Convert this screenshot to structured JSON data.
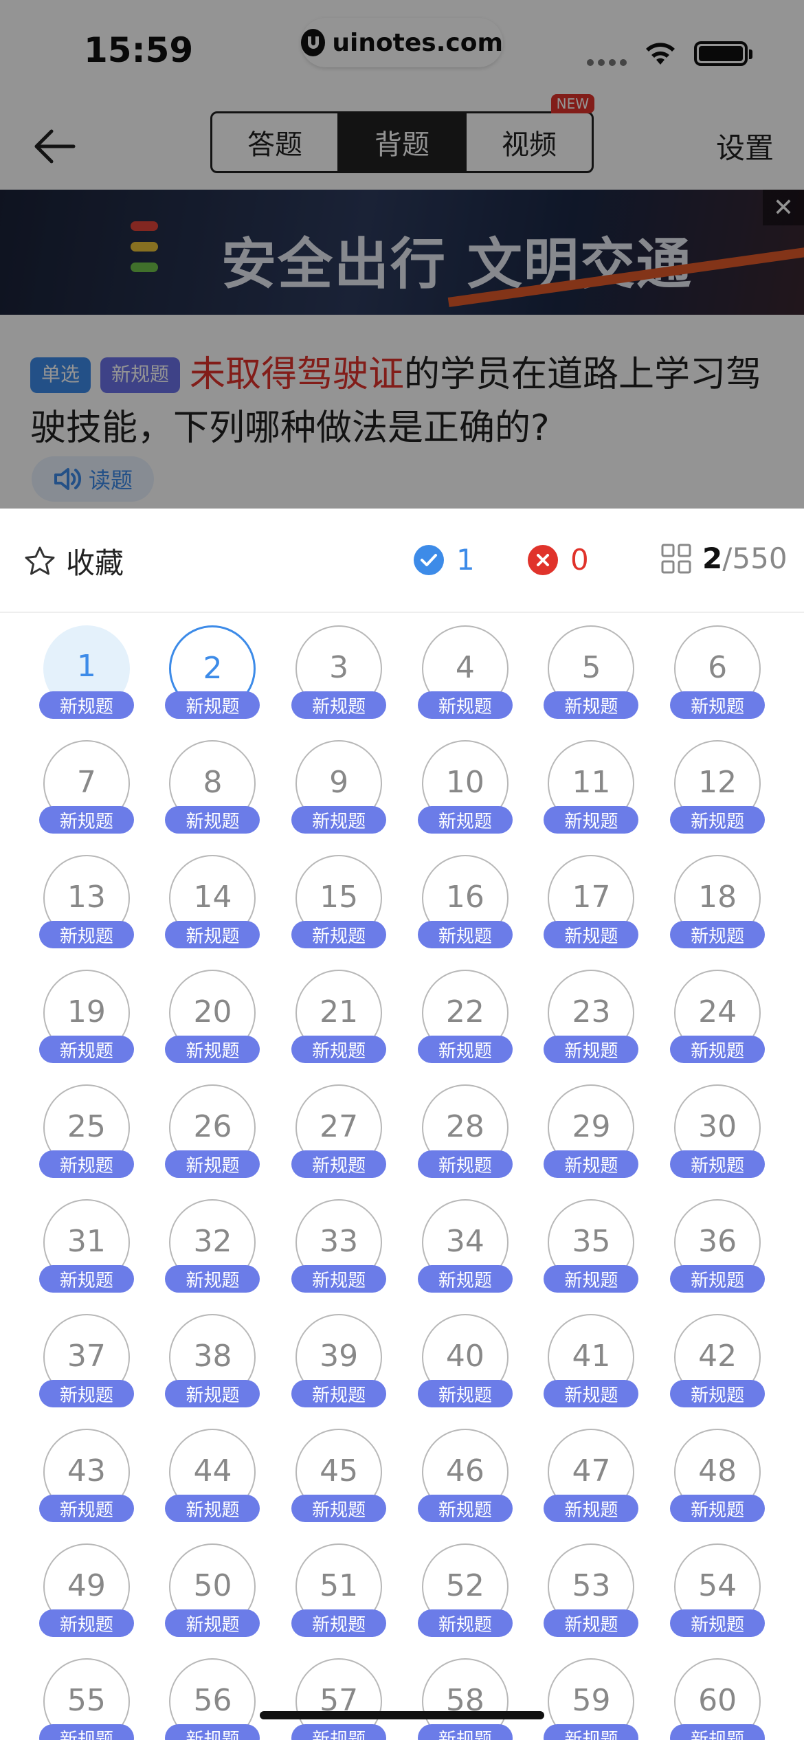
{
  "status_bar": {
    "time": "15:59",
    "url": "uinotes.com"
  },
  "nav": {
    "tabs": [
      {
        "label": "答题",
        "active": false
      },
      {
        "label": "背题",
        "active": true
      },
      {
        "label": "视频",
        "active": false,
        "badge": "NEW"
      }
    ],
    "settings_label": "设置"
  },
  "banner": {
    "text": "安全出行 文明交通",
    "close_label": "✕"
  },
  "question": {
    "tags": [
      "单选",
      "新规题"
    ],
    "highlight": "未取得驾驶证",
    "text": "的学员在道路上学习驾驶技能，下列哪种做法是正确的?",
    "read_label": "读题"
  },
  "sheet": {
    "favorite_label": "收藏",
    "correct_count": "1",
    "wrong_count": "0",
    "current_index": "2",
    "total": "/550",
    "tag_label": "新规题",
    "current_question": 1,
    "selected_question": 2,
    "questions": [
      "1",
      "2",
      "3",
      "4",
      "5",
      "6",
      "7",
      "8",
      "9",
      "10",
      "11",
      "12",
      "13",
      "14",
      "15",
      "16",
      "17",
      "18",
      "19",
      "20",
      "21",
      "22",
      "23",
      "24",
      "25",
      "26",
      "27",
      "28",
      "29",
      "30",
      "31",
      "32",
      "33",
      "34",
      "35",
      "36",
      "37",
      "38",
      "39",
      "40",
      "41",
      "42",
      "43",
      "44",
      "45",
      "46",
      "47",
      "48",
      "49",
      "50",
      "51",
      "52",
      "53",
      "54",
      "55",
      "56",
      "57",
      "58",
      "59",
      "60"
    ]
  },
  "colors": {
    "accent_blue": "#3d8be8",
    "error_red": "#e0332b",
    "tag_purple": "#6b7ce8"
  }
}
